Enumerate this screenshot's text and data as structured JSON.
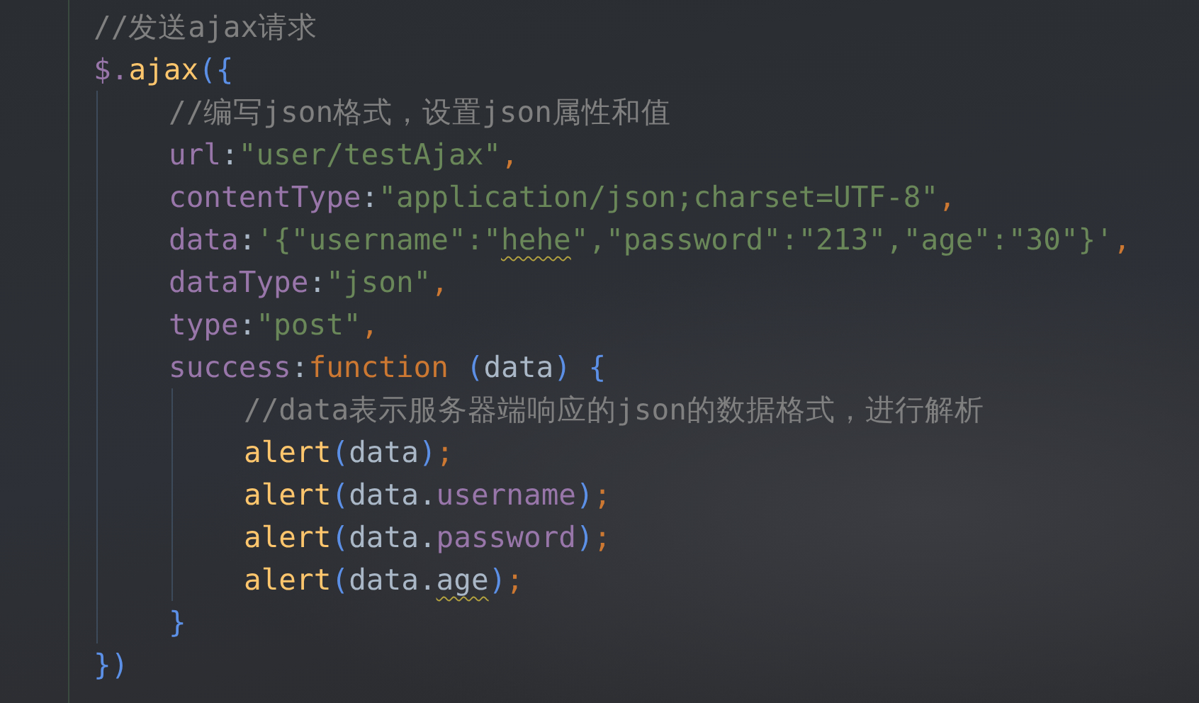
{
  "editor": {
    "lines": [
      {
        "tokens": [
          {
            "kind": "comment",
            "text": "//发送ajax请求",
            "typo": false
          }
        ]
      },
      {
        "tokens": [
          {
            "kind": "prop",
            "text": "$.",
            "typo": false
          },
          {
            "kind": "func",
            "text": "ajax",
            "typo": false
          },
          {
            "kind": "bracket",
            "text": "({",
            "typo": false
          }
        ],
        "children": [
          {
            "tokens": [
              {
                "kind": "comment",
                "text": "//编写json格式，设置json属性和值",
                "typo": false
              }
            ]
          },
          {
            "tokens": [
              {
                "kind": "prop",
                "text": "url",
                "typo": false
              },
              {
                "kind": "plain",
                "text": ":",
                "typo": false
              },
              {
                "kind": "string",
                "text": "\"user/testAjax\"",
                "typo": false
              },
              {
                "kind": "comma",
                "text": ",",
                "typo": false
              }
            ]
          },
          {
            "tokens": [
              {
                "kind": "prop",
                "text": "contentType",
                "typo": false
              },
              {
                "kind": "plain",
                "text": ":",
                "typo": false
              },
              {
                "kind": "string",
                "text": "\"application/json;charset=UTF-8\"",
                "typo": false
              },
              {
                "kind": "comma",
                "text": ",",
                "typo": false
              }
            ]
          },
          {
            "tokens": [
              {
                "kind": "prop",
                "text": "data",
                "typo": false
              },
              {
                "kind": "plain",
                "text": ":",
                "typo": false
              },
              {
                "kind": "string",
                "text": "'{\"username\":\"",
                "typo": false
              },
              {
                "kind": "string",
                "text": "hehe",
                "typo": true
              },
              {
                "kind": "string",
                "text": "\",\"password\":\"213\",\"age\":\"30\"}'",
                "typo": false
              },
              {
                "kind": "comma",
                "text": ",",
                "typo": false
              }
            ]
          },
          {
            "tokens": [
              {
                "kind": "prop",
                "text": "dataType",
                "typo": false
              },
              {
                "kind": "plain",
                "text": ":",
                "typo": false
              },
              {
                "kind": "string",
                "text": "\"json\"",
                "typo": false
              },
              {
                "kind": "comma",
                "text": ",",
                "typo": false
              }
            ]
          },
          {
            "tokens": [
              {
                "kind": "prop",
                "text": "type",
                "typo": false
              },
              {
                "kind": "plain",
                "text": ":",
                "typo": false
              },
              {
                "kind": "string",
                "text": "\"post\"",
                "typo": false
              },
              {
                "kind": "comma",
                "text": ",",
                "typo": false
              }
            ]
          },
          {
            "tokens": [
              {
                "kind": "prop",
                "text": "success",
                "typo": false
              },
              {
                "kind": "plain",
                "text": ":",
                "typo": false
              },
              {
                "kind": "keyword",
                "text": "function",
                "typo": false
              },
              {
                "kind": "bracket",
                "text": " (",
                "typo": false
              },
              {
                "kind": "var",
                "text": "data",
                "typo": false
              },
              {
                "kind": "bracket",
                "text": ") {",
                "typo": false
              }
            ],
            "children": [
              {
                "tokens": [
                  {
                    "kind": "comment",
                    "text": "//data表示服务器端响应的json的数据格式，进行解析",
                    "typo": false
                  }
                ]
              },
              {
                "tokens": [
                  {
                    "kind": "func",
                    "text": "alert",
                    "typo": false
                  },
                  {
                    "kind": "bracket",
                    "text": "(",
                    "typo": false
                  },
                  {
                    "kind": "var",
                    "text": "data",
                    "typo": false
                  },
                  {
                    "kind": "bracket",
                    "text": ")",
                    "typo": false
                  },
                  {
                    "kind": "comma",
                    "text": ";",
                    "typo": false
                  }
                ]
              },
              {
                "tokens": [
                  {
                    "kind": "func",
                    "text": "alert",
                    "typo": false
                  },
                  {
                    "kind": "bracket",
                    "text": "(",
                    "typo": false
                  },
                  {
                    "kind": "var",
                    "text": "data",
                    "typo": false
                  },
                  {
                    "kind": "plain",
                    "text": ".",
                    "typo": false
                  },
                  {
                    "kind": "prop",
                    "text": "username",
                    "typo": false
                  },
                  {
                    "kind": "bracket",
                    "text": ")",
                    "typo": false
                  },
                  {
                    "kind": "comma",
                    "text": ";",
                    "typo": false
                  }
                ]
              },
              {
                "tokens": [
                  {
                    "kind": "func",
                    "text": "alert",
                    "typo": false
                  },
                  {
                    "kind": "bracket",
                    "text": "(",
                    "typo": false
                  },
                  {
                    "kind": "var",
                    "text": "data",
                    "typo": false
                  },
                  {
                    "kind": "plain",
                    "text": ".",
                    "typo": false
                  },
                  {
                    "kind": "prop",
                    "text": "password",
                    "typo": false
                  },
                  {
                    "kind": "bracket",
                    "text": ")",
                    "typo": false
                  },
                  {
                    "kind": "comma",
                    "text": ";",
                    "typo": false
                  }
                ]
              },
              {
                "tokens": [
                  {
                    "kind": "func",
                    "text": "alert",
                    "typo": false
                  },
                  {
                    "kind": "bracket",
                    "text": "(",
                    "typo": false
                  },
                  {
                    "kind": "var",
                    "text": "data",
                    "typo": false
                  },
                  {
                    "kind": "plain",
                    "text": ".",
                    "typo": false
                  },
                  {
                    "kind": "var",
                    "text": "age",
                    "typo": true
                  },
                  {
                    "kind": "bracket",
                    "text": ")",
                    "typo": false
                  },
                  {
                    "kind": "comma",
                    "text": ";",
                    "typo": false
                  }
                ]
              }
            ]
          },
          {
            "tokens": [
              {
                "kind": "bracket",
                "text": "}",
                "typo": false
              }
            ]
          }
        ]
      },
      {
        "tokens": [
          {
            "kind": "bracket",
            "text": "})",
            "typo": false
          }
        ]
      }
    ]
  }
}
